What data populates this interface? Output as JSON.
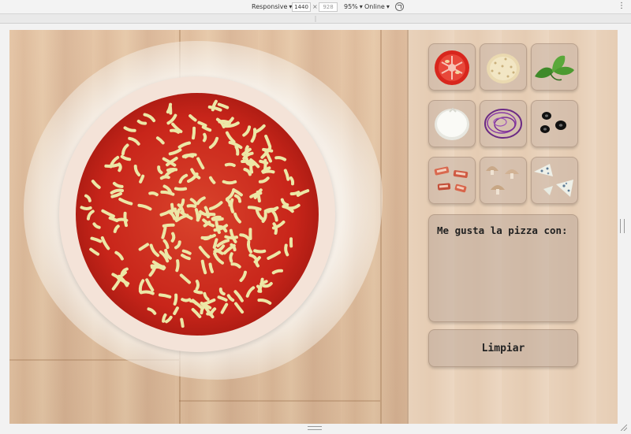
{
  "devtools": {
    "device_mode": "Responsive",
    "width": "1440",
    "height": "928",
    "zoom": "95%",
    "network": "Online"
  },
  "ingredients": [
    {
      "name": "tomate",
      "icon": "tomato-icon"
    },
    {
      "name": "queso rallado",
      "icon": "grated-cheese-icon"
    },
    {
      "name": "albahaca",
      "icon": "basil-icon"
    },
    {
      "name": "mozzarella",
      "icon": "mozzarella-icon"
    },
    {
      "name": "cebolla",
      "icon": "onion-icon"
    },
    {
      "name": "aceitunas",
      "icon": "olives-icon"
    },
    {
      "name": "bacon",
      "icon": "bacon-icon"
    },
    {
      "name": "champiñones",
      "icon": "mushrooms-icon"
    },
    {
      "name": "queso azul",
      "icon": "blue-cheese-icon"
    }
  ],
  "order": {
    "title": "Me gusta la pizza con:"
  },
  "clear_button": {
    "label": "Limpiar"
  },
  "colors": {
    "sauce": "#c8251a",
    "cheese_strands": "#ece7a6",
    "dough": "#f4e3d8"
  }
}
